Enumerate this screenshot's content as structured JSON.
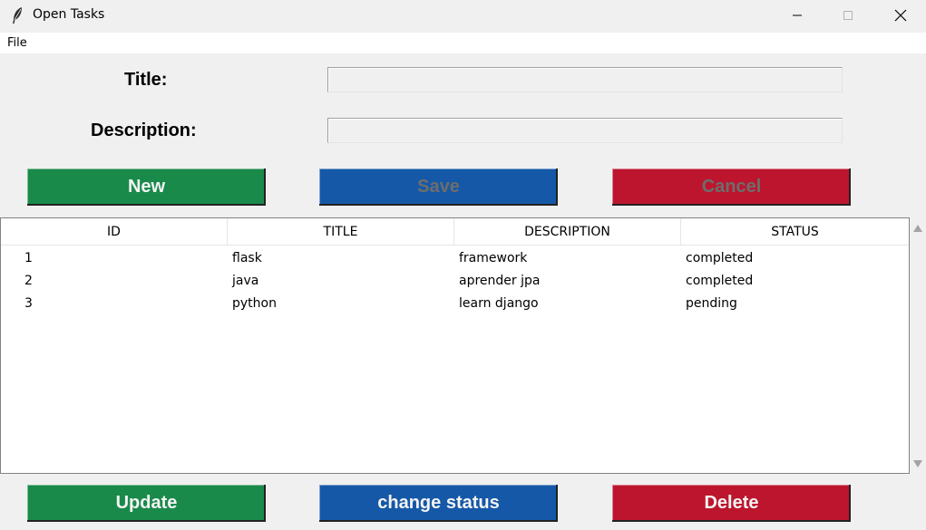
{
  "window": {
    "title": "Open Tasks",
    "icon": "feather-icon"
  },
  "menu": {
    "file": "File"
  },
  "form": {
    "title_label": "Title:",
    "title_value": "",
    "description_label": "Description:",
    "description_value": ""
  },
  "buttons": {
    "new": "New",
    "save": "Save",
    "cancel": "Cancel",
    "update": "Update",
    "change_status": "change status",
    "delete": "Delete"
  },
  "table": {
    "columns": [
      "ID",
      "TITLE",
      "DESCRIPTION",
      "STATUS"
    ],
    "rows": [
      [
        "1",
        "flask",
        "framework",
        "completed"
      ],
      [
        "2",
        "java",
        "aprender jpa",
        "completed"
      ],
      [
        "3",
        "python",
        "learn django",
        "pending"
      ]
    ]
  },
  "colors": {
    "green": "#198a4a",
    "blue": "#1558a7",
    "red": "#bd152e",
    "disabled_text": "#6d6d6d"
  }
}
